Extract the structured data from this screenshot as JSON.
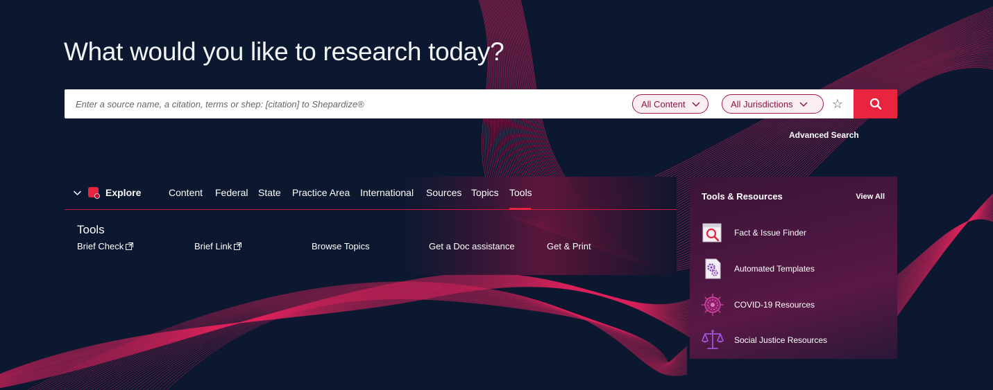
{
  "hero": {
    "headline": "What would you like to research today?"
  },
  "search": {
    "placeholder": "Enter a source name, a citation, terms or shep: [citation] to Shepardize®",
    "value": "",
    "content_filter": "All Content",
    "jurisdiction_filter": "All Jurisdictions",
    "favorite_icon": "star-icon",
    "submit_icon": "search-icon",
    "advanced_link": "Advanced Search"
  },
  "nav": {
    "explore_label": "Explore",
    "tabs": [
      {
        "label": "Content"
      },
      {
        "label": "Federal"
      },
      {
        "label": "State"
      },
      {
        "label": "Practice Area"
      },
      {
        "label": "International"
      },
      {
        "label": "Sources"
      },
      {
        "label": "Topics"
      },
      {
        "label": "Tools",
        "active": true
      }
    ]
  },
  "tools": {
    "heading": "Tools",
    "links": [
      {
        "label": "Brief Check",
        "external": true
      },
      {
        "label": "Brief Link",
        "external": true
      },
      {
        "label": "Browse Topics",
        "external": false
      },
      {
        "label": "Get a Doc assistance",
        "external": false
      },
      {
        "label": "Get & Print",
        "external": false
      }
    ]
  },
  "resources": {
    "title": "Tools & Resources",
    "view_all": "View All",
    "items": [
      {
        "label": "Fact & Issue Finder",
        "icon": "magnifier-document-icon"
      },
      {
        "label": "Automated Templates",
        "icon": "gears-document-icon"
      },
      {
        "label": "COVID-19 Resources",
        "icon": "virus-icon"
      },
      {
        "label": "Social Justice Resources",
        "icon": "scales-icon"
      }
    ]
  },
  "colors": {
    "background": "#0b1830",
    "accent": "#e8243f",
    "pill_border": "#a1184f",
    "wave": "#e0245e"
  }
}
